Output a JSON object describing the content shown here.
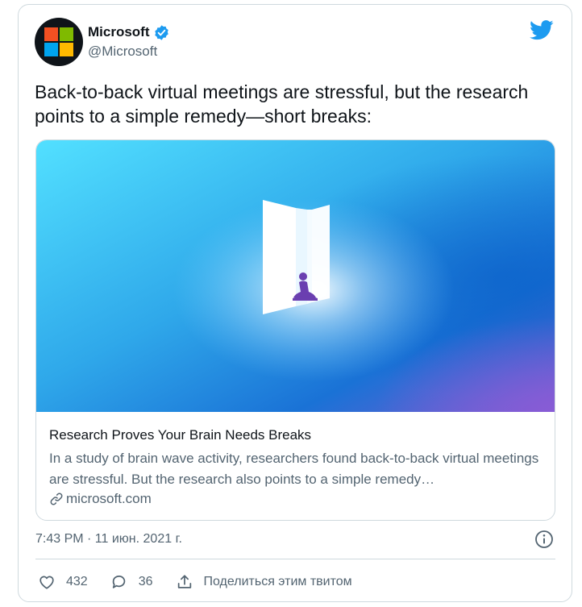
{
  "author": {
    "display_name": "Microsoft",
    "handle": "@Microsoft",
    "verified": true,
    "avatar_icon": "microsoft-logo-icon",
    "logo_colors": [
      "#f25022",
      "#7fba00",
      "#00a4ef",
      "#ffb900"
    ]
  },
  "platform_icon": "twitter-bird-icon",
  "tweet": {
    "text": "Back-to-back virtual meetings are stressful, but the research points to a simple remedy—short breaks:"
  },
  "link_card": {
    "title": "Research Proves Your Brain Needs Breaks",
    "description": "In a study of brain wave activity, researchers found back-to-back virtual meetings are stressful. But the research also points to a simple remedy…",
    "domain": "microsoft.com",
    "domain_icon": "link-icon"
  },
  "timestamp": "7:43 PM · 11 июн. 2021 г.",
  "actions": {
    "likes": "432",
    "replies": "36",
    "share_label": "Поделиться этим твитом"
  },
  "colors": {
    "accent": "#1d9bf0",
    "text_primary": "#0f1419",
    "text_secondary": "#536471",
    "border": "#cfd9de"
  }
}
